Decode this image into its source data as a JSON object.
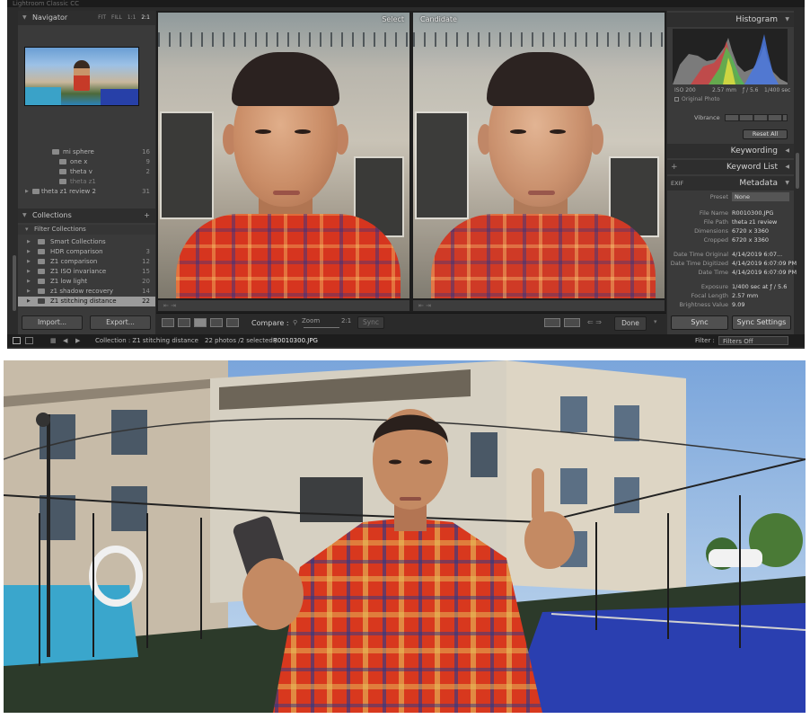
{
  "app": {
    "title": "Lightroom Classic CC"
  },
  "left_panel": {
    "navigator": {
      "title": "Navigator",
      "zoom_options": [
        "FIT",
        "FILL",
        "1:1",
        "2:1"
      ]
    },
    "folders": [
      {
        "name": "mi sphere",
        "count": "16"
      },
      {
        "name": "one x",
        "count": "9"
      },
      {
        "name": "theta v",
        "count": "2"
      },
      {
        "name": "theta z1",
        "count": ""
      },
      {
        "name": "theta z1 review 2",
        "count": "31"
      }
    ],
    "collections": {
      "title": "Collections",
      "add": "+",
      "filter_label": "Filter Collections",
      "items": [
        {
          "name": "Smart Collections",
          "count": ""
        },
        {
          "name": "HDR comparison",
          "count": "3"
        },
        {
          "name": "Z1 comparison",
          "count": "12"
        },
        {
          "name": "Z1 ISO invariance",
          "count": "15"
        },
        {
          "name": "Z1 low light",
          "count": "20"
        },
        {
          "name": "z1 shadow recovery",
          "count": "14"
        },
        {
          "name": "Z1 stitching distance",
          "count": "22"
        }
      ]
    },
    "import_label": "Import...",
    "export_label": "Export..."
  },
  "compare": {
    "select_label": "Select",
    "candidate_label": "Candidate",
    "toolbar_compare_label": "Compare :",
    "zoom_label": "Zoom",
    "zoom_value": "2:1",
    "sync_label": "Sync",
    "done_label": "Done"
  },
  "right_panel": {
    "histogram": {
      "title": "Histogram",
      "iso": "ISO 200",
      "focal": "2.57 mm",
      "aperture": "ƒ / 5.6",
      "shutter": "1/400 sec",
      "original_photo": "Original Photo"
    },
    "vibrance_label": "Vibrance",
    "reset_all_label": "Reset All",
    "keywording_label": "Keywording",
    "keyword_list_label": "Keyword List",
    "metadata_label": "Metadata",
    "exif_label": "EXIF",
    "preset_label": "Preset",
    "preset_value": "None",
    "fields": [
      {
        "key": "File Name",
        "value": "R0010300.JPG"
      },
      {
        "key": "File Path",
        "value": "theta z1 review"
      },
      {
        "key": "Dimensions",
        "value": "6720 x 3360"
      },
      {
        "key": "Cropped",
        "value": "6720 x 3360"
      },
      {
        "key": "Date Time Original",
        "value": "4/14/2019 6:07..."
      },
      {
        "key": "Date Time Digitized",
        "value": "4/14/2019 6:07:09 PM"
      },
      {
        "key": "Date Time",
        "value": "4/14/2019 6:07:09 PM"
      },
      {
        "key": "Exposure",
        "value": "1/400 sec at ƒ / 5.6"
      },
      {
        "key": "Focal Length",
        "value": "2.57 mm"
      },
      {
        "key": "Brightness Value",
        "value": "9.09"
      }
    ],
    "sync_label": "Sync",
    "sync_settings_label": "Sync Settings"
  },
  "filmstrip": {
    "collection_text": "Collection : Z1 stitching distance",
    "count_text": "22 photos /2 selected /",
    "selected_file": "R0010300.JPG",
    "filter_label": "Filter :",
    "filter_value": "Filters Off"
  },
  "colors": {
    "panel_bg": "#3a3a3a",
    "header_bg": "#2e2e2e",
    "selected_row": "#9b9b9b",
    "shirt_red": "#d6351f",
    "court_blue": "#2a3fb0",
    "pool_blue": "#3aa6cc"
  }
}
